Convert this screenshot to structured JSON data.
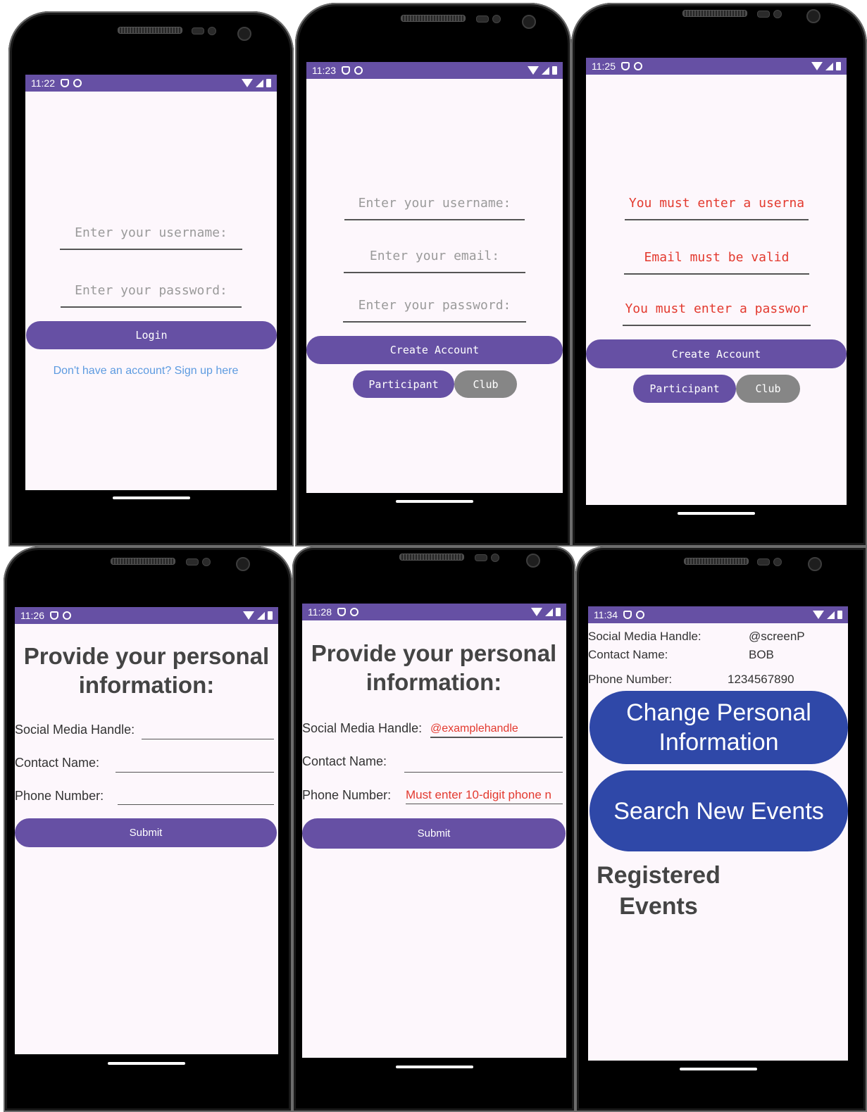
{
  "screens": [
    {
      "time": "11:22",
      "username_placeholder": "Enter your username:",
      "password_placeholder": "Enter your password:",
      "login_label": "Login",
      "signup_link": "Don't have an account? Sign up here"
    },
    {
      "time": "11:23",
      "username_placeholder": "Enter your username:",
      "email_placeholder": "Enter your email:",
      "password_placeholder": "Enter your password:",
      "create_label": "Create Account",
      "participant_label": "Participant",
      "club_label": "Club"
    },
    {
      "time": "11:25",
      "username_error": "You must enter a userna",
      "email_error": "Email must be valid",
      "password_error": "You must enter a passwor",
      "create_label": "Create Account",
      "participant_label": "Participant",
      "club_label": "Club"
    },
    {
      "time": "11:26",
      "title": "Provide your personal information:",
      "social_label": "Social Media Handle:",
      "contact_label": "Contact Name:",
      "phone_label": "Phone Number:",
      "submit_label": "Submit"
    },
    {
      "time": "11:28",
      "title": "Provide your personal information:",
      "social_label": "Social Media Handle:",
      "social_value": "@examplehandle",
      "contact_label": "Contact Name:",
      "phone_label": "Phone Number:",
      "phone_error": "Must enter 10-digit phone n",
      "submit_label": "Submit"
    },
    {
      "time": "11:34",
      "social_label": "Social Media Handle:",
      "social_value": "@screenP",
      "contact_label": "Contact Name:",
      "contact_value": "BOB",
      "phone_label": "Phone Number:",
      "phone_value": "1234567890",
      "change_button": "Change Personal Information",
      "search_button": "Search New Events",
      "registered_heading": "Registered Events"
    }
  ],
  "colors": {
    "primary": "#6650a4",
    "blue_button": "#2f48a8",
    "error": "#e33a2f",
    "link": "#5d9be0",
    "gray_button": "#868686"
  }
}
